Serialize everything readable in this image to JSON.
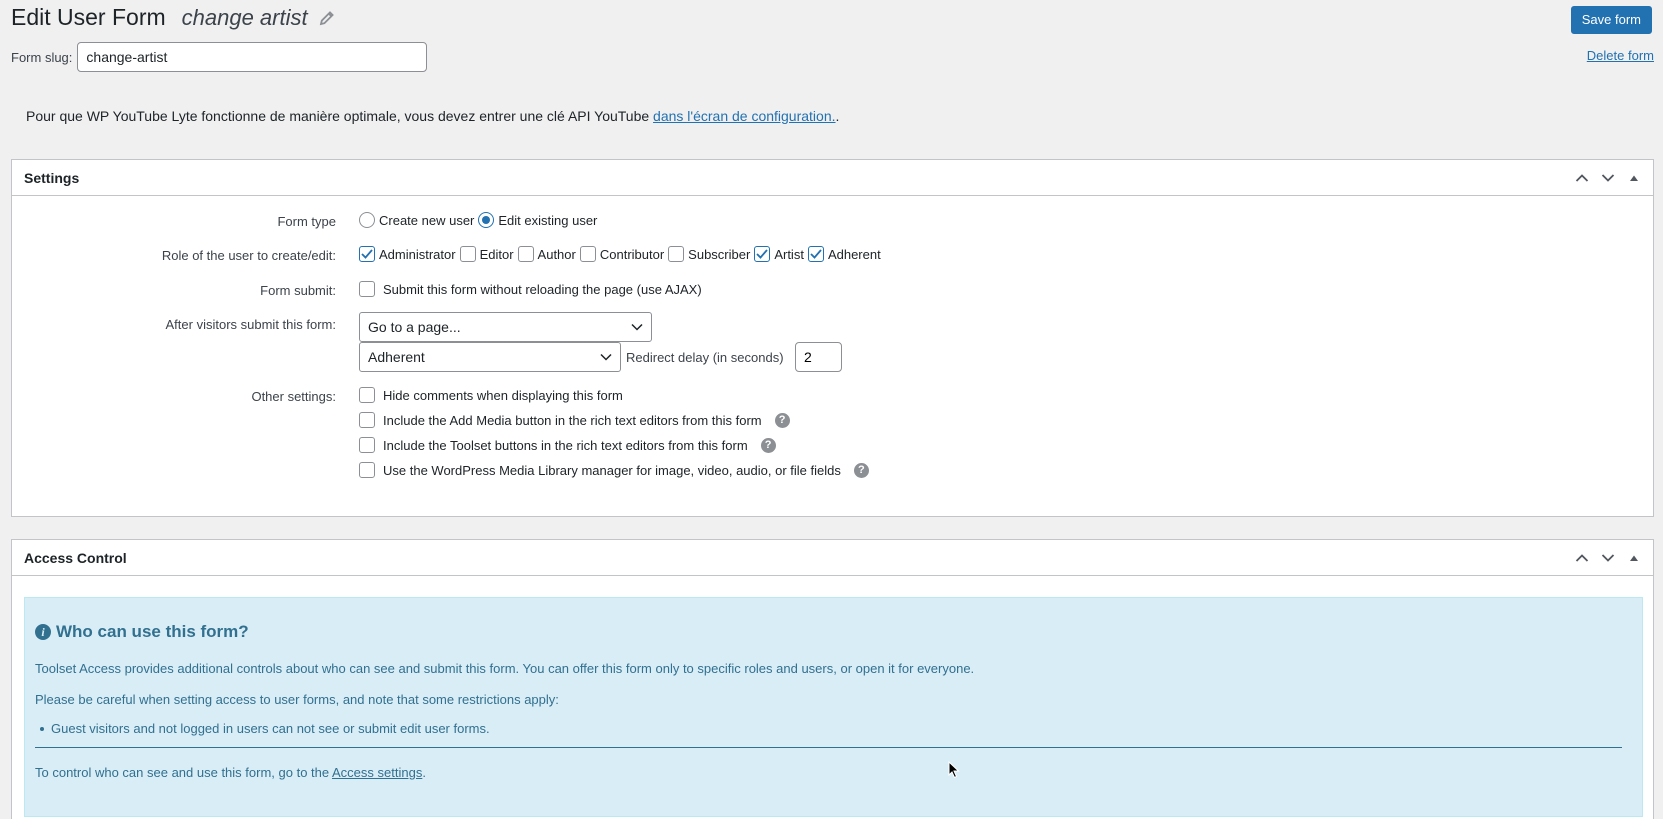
{
  "header": {
    "page_title": "Edit User Form",
    "form_title": "change artist",
    "save_label": "Save form"
  },
  "slug": {
    "label": "Form slug:",
    "value": "change-artist",
    "delete_label": "Delete form"
  },
  "notice": {
    "text": "Pour que WP YouTube Lyte fonctionne de manière optimale, vous devez entrer une clé API YouTube ",
    "link": "dans l'écran de configuration.",
    "suffix": "."
  },
  "settings": {
    "title": "Settings",
    "form_type": {
      "label": "Form type",
      "options": [
        {
          "label": "Create new user",
          "checked": false
        },
        {
          "label": "Edit existing user",
          "checked": true
        }
      ]
    },
    "roles": {
      "label": "Role of the user to create/edit:",
      "options": [
        {
          "label": "Administrator",
          "checked": true
        },
        {
          "label": "Editor",
          "checked": false
        },
        {
          "label": "Author",
          "checked": false
        },
        {
          "label": "Contributor",
          "checked": false
        },
        {
          "label": "Subscriber",
          "checked": false
        },
        {
          "label": "Artist",
          "checked": true
        },
        {
          "label": "Adherent",
          "checked": true
        }
      ]
    },
    "form_submit": {
      "label": "Form submit:",
      "option": "Submit this form without reloading the page (use AJAX)"
    },
    "after_submit": {
      "label": "After visitors submit this form:",
      "action": "Go to a page...",
      "page": "Adherent",
      "delay_label": "Redirect delay (in seconds)",
      "delay_value": "2"
    },
    "other": {
      "label": "Other settings:",
      "options": [
        {
          "label": "Hide comments when displaying this form",
          "help": false
        },
        {
          "label": "Include the Add Media button in the rich text editors from this form",
          "help": true
        },
        {
          "label": "Include the Toolset buttons in the rich text editors from this form",
          "help": true
        },
        {
          "label": "Use the WordPress Media Library manager for image, video, audio, or file fields",
          "help": true
        }
      ]
    }
  },
  "access": {
    "title": "Access Control",
    "info_title": "Who can use this form?",
    "p1": "Toolset Access provides additional controls about who can see and submit this form. You can offer this form only to specific roles and users, or open it for everyone.",
    "p2": "Please be careful when setting access to user forms, and note that some restrictions apply:",
    "li1": "Guest visitors and not logged in users can not see or submit edit user forms.",
    "p3_prefix": "To control who can see and use this form, go to the ",
    "p3_link": "Access settings",
    "p3_suffix": "."
  },
  "colors": {
    "primary": "#2271b1",
    "info_bg": "#d9edf7",
    "info_text": "#31708f"
  }
}
